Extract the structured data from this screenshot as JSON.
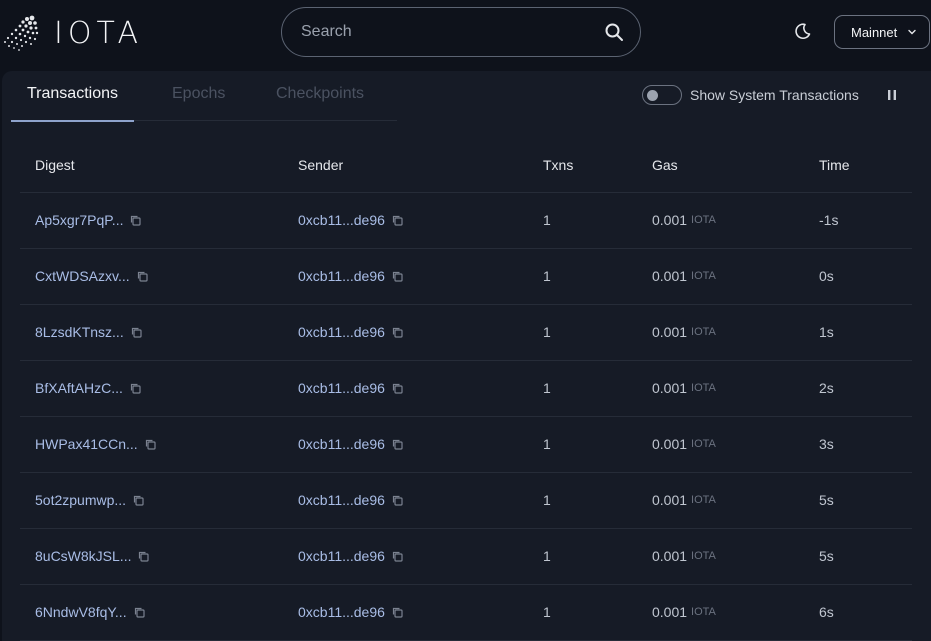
{
  "header": {
    "logo_text": "IOTA",
    "search_placeholder": "Search",
    "network": "Mainnet"
  },
  "tabs": [
    {
      "label": "Transactions",
      "active": true
    },
    {
      "label": "Epochs",
      "active": false
    },
    {
      "label": "Checkpoints",
      "active": false
    }
  ],
  "system_toggle": {
    "label": "Show System Transactions",
    "on": false
  },
  "table": {
    "columns": [
      "Digest",
      "Sender",
      "Txns",
      "Gas",
      "Time"
    ],
    "gas_unit": "IOTA",
    "rows": [
      {
        "digest": "Ap5xgr7PqP...",
        "sender": "0xcb11...de96",
        "txns": "1",
        "gas": "0.001",
        "time": "-1s"
      },
      {
        "digest": "CxtWDSAzxv...",
        "sender": "0xcb11...de96",
        "txns": "1",
        "gas": "0.001",
        "time": "0s"
      },
      {
        "digest": "8LzsdKTnsz...",
        "sender": "0xcb11...de96",
        "txns": "1",
        "gas": "0.001",
        "time": "1s"
      },
      {
        "digest": "BfXAftAHzC...",
        "sender": "0xcb11...de96",
        "txns": "1",
        "gas": "0.001",
        "time": "2s"
      },
      {
        "digest": "HWPax41CCn...",
        "sender": "0xcb11...de96",
        "txns": "1",
        "gas": "0.001",
        "time": "3s"
      },
      {
        "digest": "5ot2zpumwp...",
        "sender": "0xcb11...de96",
        "txns": "1",
        "gas": "0.001",
        "time": "5s"
      },
      {
        "digest": "8uCsW8kJSL...",
        "sender": "0xcb11...de96",
        "txns": "1",
        "gas": "0.001",
        "time": "5s"
      },
      {
        "digest": "6NndwV8fqY...",
        "sender": "0xcb11...de96",
        "txns": "1",
        "gas": "0.001",
        "time": "6s"
      }
    ]
  }
}
